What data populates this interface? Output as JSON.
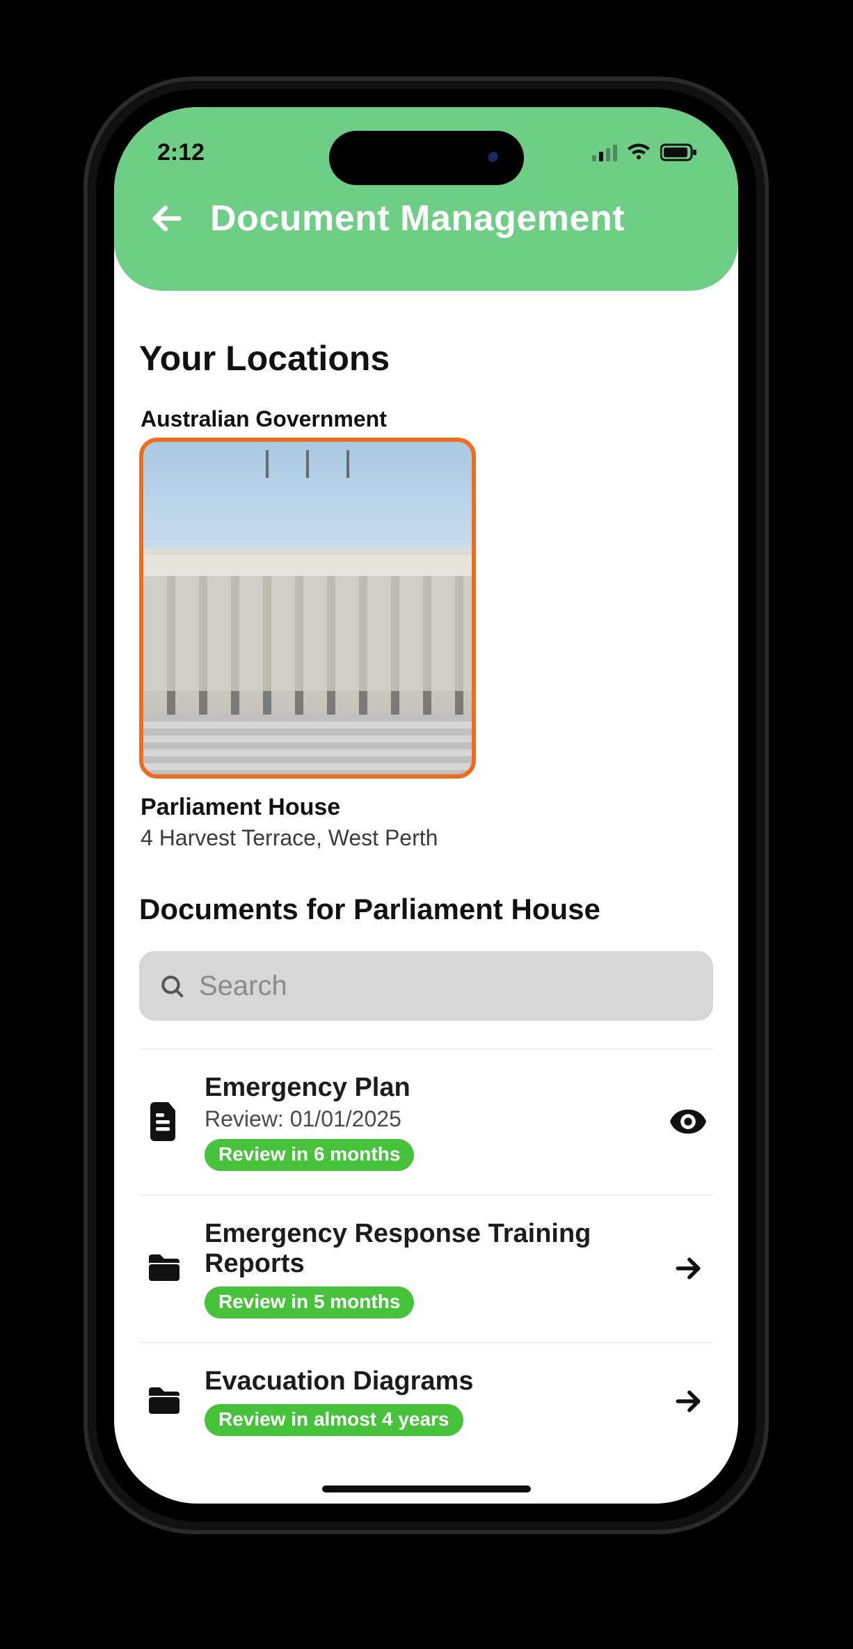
{
  "status": {
    "time": "2:12"
  },
  "header": {
    "title": "Document Management"
  },
  "sections": {
    "locations_heading": "Your Locations",
    "documents_heading": "Documents for Parliament House"
  },
  "location": {
    "org": "Australian Government",
    "name": "Parliament House",
    "address": "4 Harvest Terrace, West Perth"
  },
  "search": {
    "placeholder": "Search",
    "value": ""
  },
  "colors": {
    "accent": "#6ece86",
    "pill": "#46c33b",
    "card_border": "#f26a1b"
  },
  "documents": [
    {
      "icon": "file",
      "title": "Emergency Plan",
      "subtitle": "Review: 01/01/2025",
      "pill": "Review in 6 months",
      "action": "view"
    },
    {
      "icon": "folder",
      "title": "Emergency Response Training Reports",
      "subtitle": "",
      "pill": "Review in 5 months",
      "action": "open"
    },
    {
      "icon": "folder",
      "title": "Evacuation Diagrams",
      "subtitle": "",
      "pill": "Review in almost 4 years",
      "action": "open"
    }
  ]
}
